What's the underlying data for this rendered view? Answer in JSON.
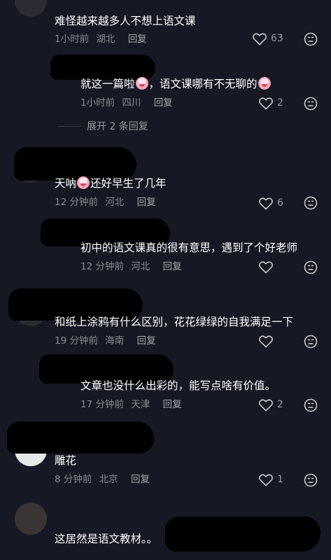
{
  "comments": [
    {
      "text": "难怪越来越多人不想上语文课",
      "time": "1小时前",
      "location": "湖北",
      "reply_label": "回复",
      "likes": "63"
    },
    {
      "text_a": "就这一篇啦",
      "text_b": "，语文课哪有不无聊的",
      "time": "1小时前",
      "location": "四川",
      "reply_label": "回复",
      "likes": "2"
    },
    {
      "text_a": "天呐",
      "text_b": "还好早生了几年",
      "time": "12 分钟前",
      "location": "河北",
      "reply_label": "回复",
      "likes": "6"
    },
    {
      "text": "初中的语文课真的很有意思，遇到了个好老师",
      "time": "12 分钟前",
      "location": "河北",
      "reply_label": "回复",
      "likes": ""
    },
    {
      "text": "和纸上涂鸦有什么区别，花花绿绿的自我满足一下",
      "time": "19 分钟前",
      "location": "海南",
      "reply_label": "回复",
      "likes": ""
    },
    {
      "text": "文章也没什么出彩的，能写点啥有价值。",
      "time": "17 分钟前",
      "location": "天津",
      "reply_label": "回复",
      "likes": "2"
    },
    {
      "text": "雕花",
      "time": "8 分钟前",
      "location": "北京",
      "reply_label": "回复",
      "likes": "1"
    },
    {
      "text": "这居然是语文教材。。",
      "time": "",
      "location": "",
      "reply_label": "",
      "likes": ""
    }
  ],
  "expand_replies": "展开 2 条回复",
  "icons": {
    "like": "heart-outline-icon",
    "dislike": "dislike-face-icon",
    "emoji": "crying-face-emoji-icon"
  },
  "colors": {
    "background": "#161823",
    "text": "#ffffff",
    "meta": "#8a8b91",
    "icon": "#9a9ba0"
  }
}
